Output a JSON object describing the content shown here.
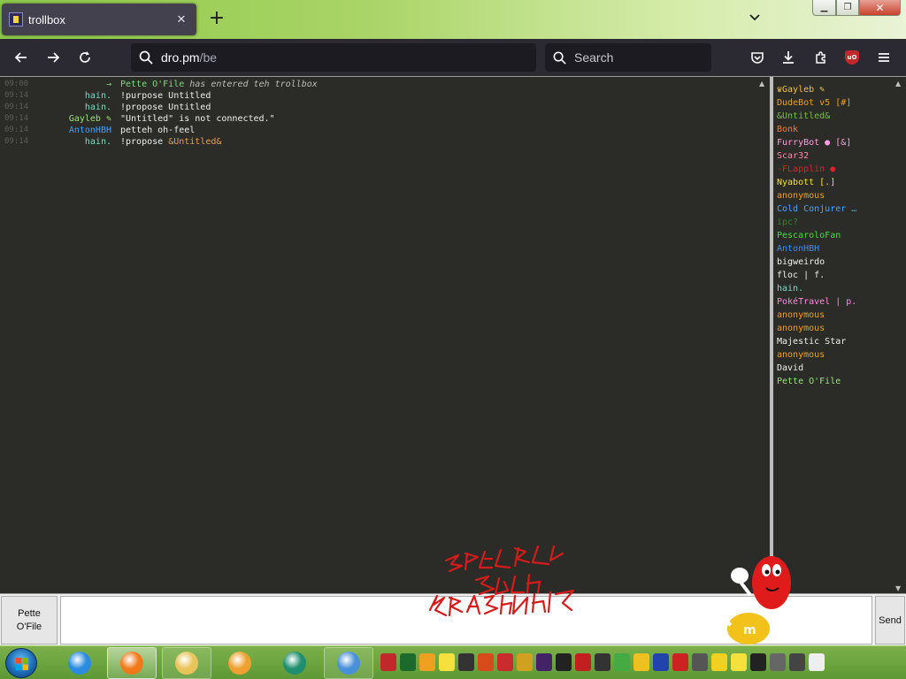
{
  "browser": {
    "tab_title": "trollbox",
    "url_host": "dro.pm",
    "url_path": "/be",
    "search_placeholder": "Search"
  },
  "chat": {
    "messages": [
      {
        "type": "system",
        "time": "09:00",
        "nick": "Pette O'File",
        "nick_color": "#7fd97f",
        "text": "has entered teh trollbox"
      },
      {
        "type": "message",
        "time": "09:14",
        "nick": "hain.",
        "nick_color": "#7fd9c9",
        "text": "!purpose Untitled"
      },
      {
        "type": "message",
        "time": "09:14",
        "nick": "hain.",
        "nick_color": "#7fd9c9",
        "text": "!propose Untitled"
      },
      {
        "type": "message",
        "time": "09:14",
        "nick": "Gayleb ✎",
        "nick_color": "#9be27a",
        "text": "\"Untitled\" is not connected.\""
      },
      {
        "type": "message",
        "time": "09:14",
        "nick": "AntonHBH",
        "nick_color": "#3fa1ff",
        "text": "petteh oh-feel"
      },
      {
        "type": "message",
        "time": "09:14",
        "nick": "hain.",
        "nick_color": "#7fd9c9",
        "text": "!propose ",
        "text_extra": "&Untitled&",
        "text_extra_color": "#e6a04a"
      }
    ]
  },
  "users": [
    {
      "name": "♛Gayleb ✎",
      "color": "#f0c24a"
    },
    {
      "name": "DudeBot v5 [#]",
      "color": "#f0a020"
    },
    {
      "name": "&Untitled&",
      "color": "#73c33f"
    },
    {
      "name": "Bonk",
      "color": "#ff7a33"
    },
    {
      "name": "FurryBot ● [&]",
      "color": "#ff9de0"
    },
    {
      "name": "Scar32",
      "color": "#ff8aa8"
    },
    {
      "name": "-FLapplin ●",
      "color": "#e0202a"
    },
    {
      "name": "Nyabott [.]",
      "color": "#f5e03c"
    },
    {
      "name": "anonymous",
      "color": "#f0a020"
    },
    {
      "name": "Cold Conjurer …",
      "color": "#4aa6ff"
    },
    {
      "name": "ipc?",
      "color": "#2b8a2b"
    },
    {
      "name": "PescaroloFan",
      "color": "#44dd44"
    },
    {
      "name": "AntonHBH",
      "color": "#3a8cff"
    },
    {
      "name": "bigweirdo",
      "color": "#f0f0f0"
    },
    {
      "name": "floc | f.",
      "color": "#f0f0f0"
    },
    {
      "name": "hain.",
      "color": "#7fd9c9"
    },
    {
      "name": "PokéTravel | p.",
      "color": "#ff8ae0"
    },
    {
      "name": "anonymous",
      "color": "#f0a020"
    },
    {
      "name": "anonymous",
      "color": "#f0a020"
    },
    {
      "name": "Majestic Star",
      "color": "#f0f0f0"
    },
    {
      "name": "anonymous",
      "color": "#f0a020"
    },
    {
      "name": "David",
      "color": "#f0f0f0"
    },
    {
      "name": "Pette O'File",
      "color": "#9be27a"
    }
  ],
  "input": {
    "nick_line1": "Pette",
    "nick_line2": "O'File",
    "send_label": "Send"
  },
  "taskbar": {
    "apps": [
      {
        "name": "internet-explorer-icon",
        "color": "#2a8be0",
        "state": "normal"
      },
      {
        "name": "firefox-icon",
        "color": "#f07a1a",
        "state": "active"
      },
      {
        "name": "file-explorer-icon",
        "color": "#e8c45a",
        "state": "pinned"
      },
      {
        "name": "media-player-icon",
        "color": "#f0a030",
        "state": "normal"
      },
      {
        "name": "media-center-icon",
        "color": "#1f8f6f",
        "state": "normal"
      },
      {
        "name": "remote-desktop-icon",
        "color": "#4a90d8",
        "state": "pinned"
      }
    ],
    "tray_colors": [
      "#c0282c",
      "#1c6a2c",
      "#f0a020",
      "#f5e03c",
      "#333333",
      "#d84a1a",
      "#c82c2c",
      "#d0a020",
      "#442266",
      "#222222",
      "#c02020",
      "#333333",
      "#44aa44",
      "#f0c020",
      "#2244aa",
      "#cc2222",
      "#555555",
      "#f0d020",
      "#f5e03c",
      "#222222",
      "#666666",
      "#444444",
      "#eeeeee"
    ]
  }
}
